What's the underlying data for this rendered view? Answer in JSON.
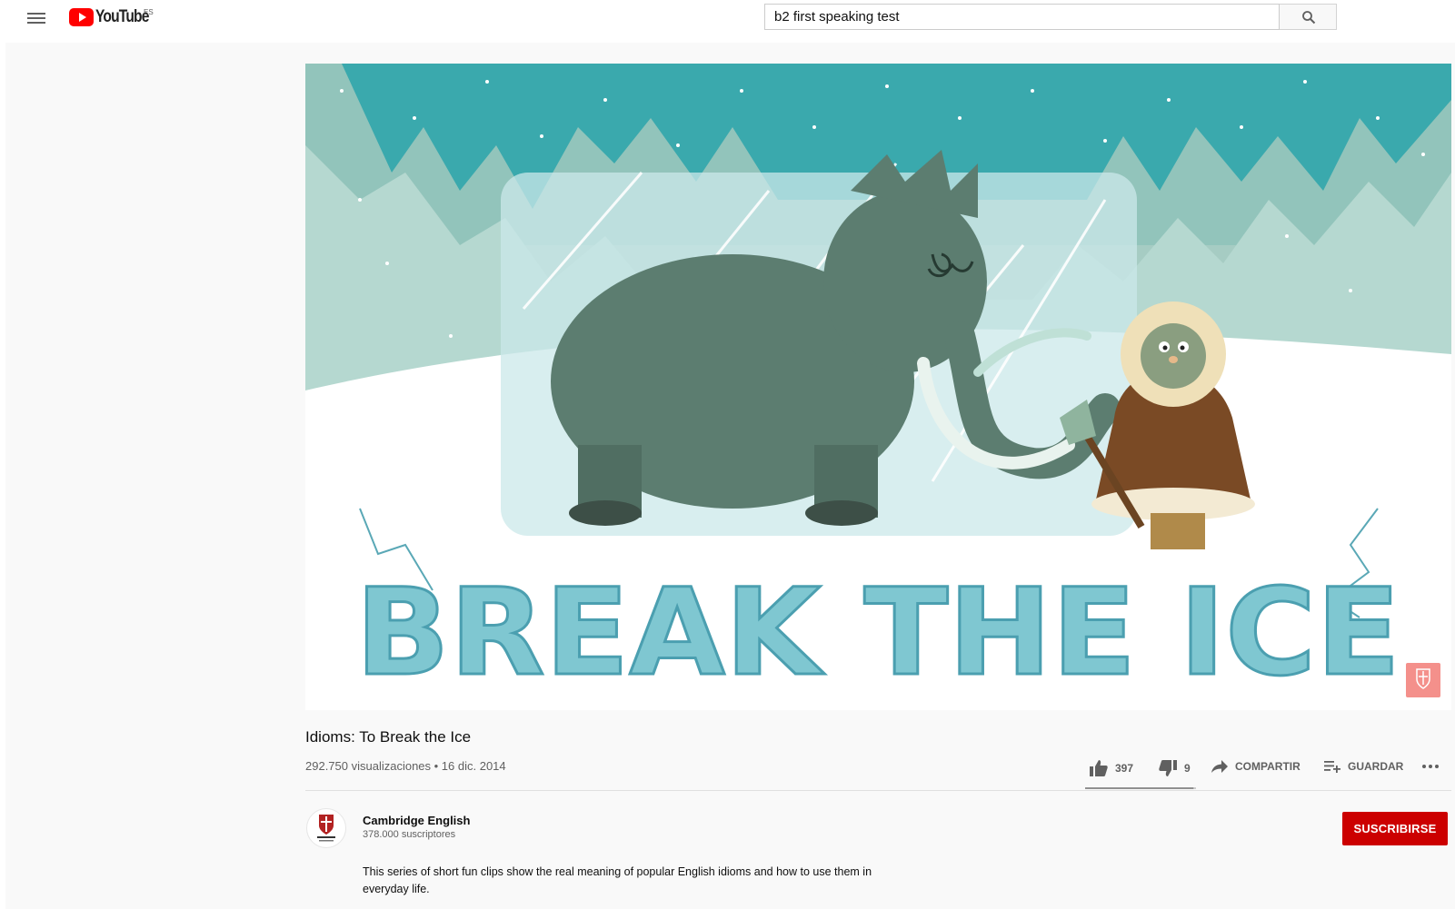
{
  "header": {
    "logo_text": "YouTube",
    "country_code": "ES",
    "search_value": "b2 first speaking test"
  },
  "video": {
    "title_art": "BREAK THE ICE",
    "title": "Idioms: To Break the Ice",
    "view_info": "292.750 visualizaciones • 16 dic. 2014",
    "likes": "397",
    "dislikes": "9",
    "like_ratio": 0.978,
    "share_label": "COMPARTIR",
    "save_label": "GUARDAR"
  },
  "channel": {
    "name": "Cambridge English",
    "subscribers": "378.000 suscriptores",
    "subscribe_label": "SUSCRIBIRSE"
  },
  "description": "This series of short fun clips show the real meaning of popular English idioms and how to use them in everyday life.",
  "colors": {
    "brand_red": "#ff0000",
    "subscribe_red": "#cc0000",
    "sky_teal": "#3aa9ad",
    "ice_blue": "#7fc7d1",
    "mammoth_green": "#5c7d70",
    "coat_brown": "#7a4a25"
  }
}
